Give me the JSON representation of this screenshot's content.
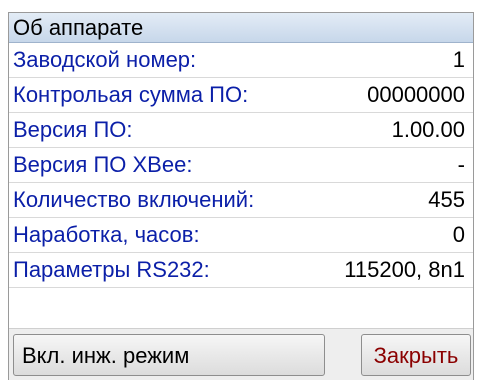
{
  "window": {
    "title": "Об аппарате"
  },
  "info": {
    "rows": [
      {
        "label": "Заводской номер:",
        "value": "1"
      },
      {
        "label": "Контрольая сумма ПО:",
        "value": "00000000"
      },
      {
        "label": "Версия ПО:",
        "value": "1.00.00"
      },
      {
        "label": "Версия ПО XBee:",
        "value": "-"
      },
      {
        "label": "Количество включений:",
        "value": "455"
      },
      {
        "label": "Наработка, часов:",
        "value": "0"
      },
      {
        "label": "Параметры RS232:",
        "value": "115200, 8n1"
      }
    ]
  },
  "buttons": {
    "engineering_mode": "Вкл. инж. режим",
    "close": "Закрыть"
  },
  "colors": {
    "label": "#0b1fa8",
    "value": "#000000",
    "close_text": "#8b0000",
    "titlebar": "#c7d7ea"
  }
}
